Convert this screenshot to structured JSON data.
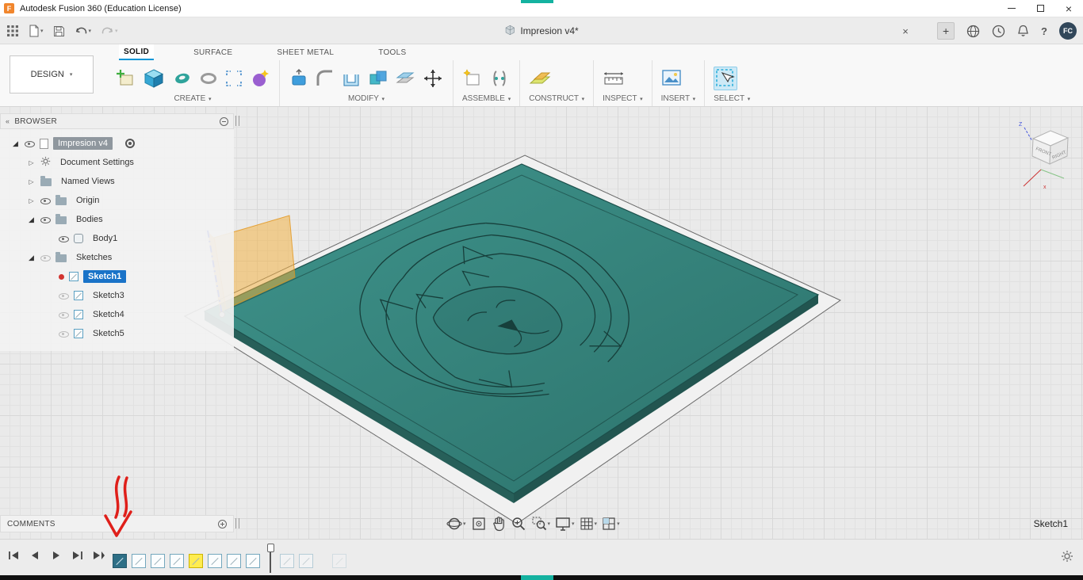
{
  "titlebar": {
    "title": "Autodesk Fusion 360 (Education License)"
  },
  "quickbar": {
    "document_tab": "Impresion v4*",
    "avatar": "FC"
  },
  "icons": {
    "close": "×",
    "plus": "+",
    "help": "?",
    "caret": "▾",
    "chevron_collapsed": "▷",
    "chevron_expanded": "◢",
    "double_left": "«"
  },
  "ribbon": {
    "design_label": "DESIGN",
    "tabs": [
      {
        "label": "SOLID",
        "active": true
      },
      {
        "label": "SURFACE"
      },
      {
        "label": "SHEET METAL"
      },
      {
        "label": "TOOLS"
      }
    ],
    "groups": [
      {
        "label": "CREATE"
      },
      {
        "label": "MODIFY"
      },
      {
        "label": "ASSEMBLE"
      },
      {
        "label": "CONSTRUCT"
      },
      {
        "label": "INSPECT"
      },
      {
        "label": "INSERT"
      },
      {
        "label": "SELECT"
      }
    ]
  },
  "browser": {
    "header": "BROWSER",
    "tree": [
      {
        "label": "Impresion v4",
        "selected": "gray"
      },
      {
        "label": "Document Settings"
      },
      {
        "label": "Named Views"
      },
      {
        "label": "Origin"
      },
      {
        "label": "Bodies"
      },
      {
        "label": "Body1"
      },
      {
        "label": "Sketches"
      },
      {
        "label": "Sketch1",
        "selected": "blue"
      },
      {
        "label": "Sketch3"
      },
      {
        "label": "Sketch4"
      },
      {
        "label": "Sketch5"
      }
    ]
  },
  "comments": {
    "header": "COMMENTS"
  },
  "viewport": {
    "active_sketch": "Sketch1",
    "viewcube": {
      "front": "FRONT",
      "right": "RIGHT",
      "axis_z": "Z",
      "axis_x": "x"
    }
  },
  "colors": {
    "plate_teal": "#37837c",
    "fusion_blue": "#0696d7",
    "sketch_highlight_orange": "#f0a73e",
    "selection_blue": "#1a73c8",
    "recording_teal": "#14b2a0",
    "annotation_red": "#df1f1a"
  }
}
